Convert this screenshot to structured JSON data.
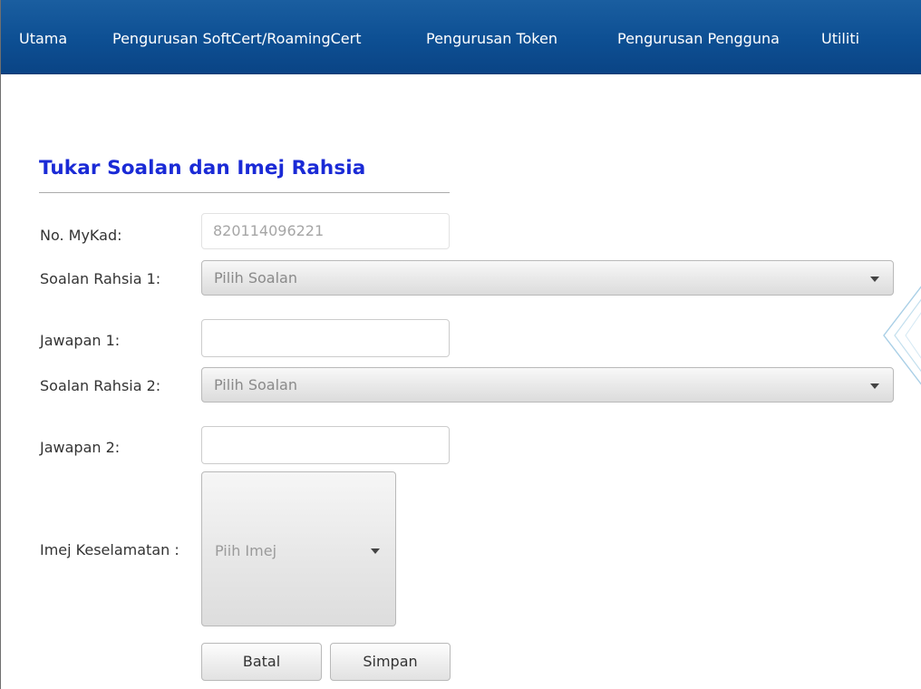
{
  "nav": {
    "items": [
      {
        "label": "Utama"
      },
      {
        "label": "Pengurusan SoftCert/RoamingCert"
      },
      {
        "label": "Pengurusan Token"
      },
      {
        "label": "Pengurusan Pengguna"
      },
      {
        "label": "Utiliti"
      }
    ]
  },
  "page": {
    "title": "Tukar Soalan dan Imej Rahsia"
  },
  "form": {
    "mykad": {
      "label": "No. MyKad:",
      "value": "820114096221"
    },
    "soalan1": {
      "label": "Soalan Rahsia 1:",
      "selected": "Pilih Soalan"
    },
    "jawapan1": {
      "label": "Jawapan 1:",
      "value": ""
    },
    "soalan2": {
      "label": "Soalan Rahsia 2:",
      "selected": "Pilih Soalan"
    },
    "jawapan2": {
      "label": "Jawapan 2:",
      "value": ""
    },
    "imej": {
      "label": "Imej Keselamatan :",
      "selected": "Piih Imej"
    }
  },
  "actions": {
    "cancel_label": "Batal",
    "save_label": "Simpan"
  },
  "colors": {
    "nav_bg": "#0d4f93",
    "title": "#1a2ad6"
  }
}
